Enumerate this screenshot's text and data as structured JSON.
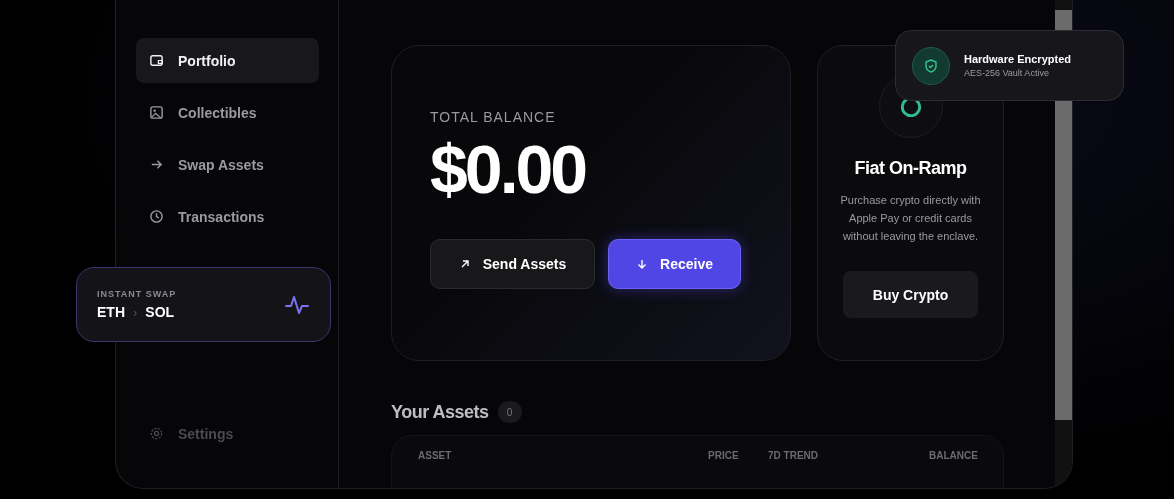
{
  "sidebar": {
    "items": [
      {
        "label": "Portfolio",
        "kind": "wallet",
        "selected": true
      },
      {
        "label": "Collectibles",
        "kind": "image",
        "selected": false
      },
      {
        "label": "Swap Assets",
        "kind": "swap",
        "selected": false
      },
      {
        "label": "Transactions",
        "kind": "history",
        "selected": false
      }
    ],
    "settings": "Settings"
  },
  "instant_swap": {
    "label": "INSTANT SWAP",
    "from": "ETH",
    "separator": "›",
    "to": "SOL"
  },
  "balance_card": {
    "label": "TOTAL BALANCE",
    "amount": "$0.00",
    "buttons": [
      {
        "label": "Send Assets",
        "kind": "secondary"
      },
      {
        "label": "Receive",
        "kind": "primary"
      }
    ]
  },
  "fiat_card": {
    "title": "Fiat On-Ramp",
    "text": "Purchase crypto directly with Apple Pay or credit cards without leaving the enclave.",
    "button": "Buy Crypto"
  },
  "toast": {
    "title": "Hardware Encrypted",
    "subtitle": "AES-256 Vault Active"
  },
  "assets": {
    "title": "Your Assets",
    "count": "0",
    "columns": [
      "ASSET",
      "PRICE",
      "7D TREND",
      "BALANCE"
    ]
  }
}
